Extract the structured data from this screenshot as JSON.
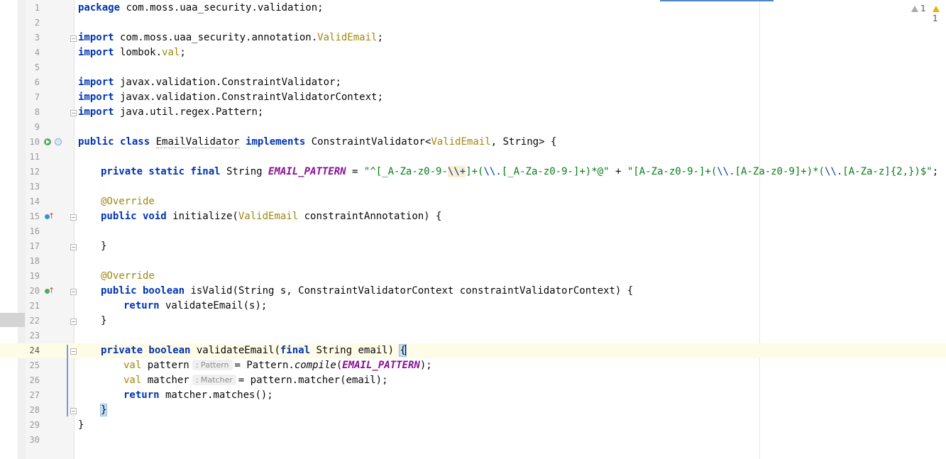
{
  "inspections": {
    "weak_count": "1",
    "warning_count": "1"
  },
  "lines": [
    {
      "num": "1"
    },
    {
      "num": "2"
    },
    {
      "num": "3"
    },
    {
      "num": "4"
    },
    {
      "num": "5"
    },
    {
      "num": "6"
    },
    {
      "num": "7"
    },
    {
      "num": "8"
    },
    {
      "num": "9"
    },
    {
      "num": "10"
    },
    {
      "num": "11"
    },
    {
      "num": "12"
    },
    {
      "num": "13"
    },
    {
      "num": "14"
    },
    {
      "num": "15"
    },
    {
      "num": "16"
    },
    {
      "num": "17"
    },
    {
      "num": "18"
    },
    {
      "num": "19"
    },
    {
      "num": "20"
    },
    {
      "num": "21"
    },
    {
      "num": "22"
    },
    {
      "num": "23"
    },
    {
      "num": "24"
    },
    {
      "num": "25"
    },
    {
      "num": "26"
    },
    {
      "num": "27"
    },
    {
      "num": "28"
    },
    {
      "num": "29"
    },
    {
      "num": "30"
    }
  ],
  "code": {
    "l1_kw": "package",
    "l1_rest": " com.moss.uaa_security.validation;",
    "l3_kw": "import",
    "l3_a": " com.moss.uaa_security.annotation.",
    "l3_type": "ValidEmail",
    "l3_b": ";",
    "l4_kw": "import",
    "l4_a": " lombok.",
    "l4_type": "val",
    "l4_b": ";",
    "l6_kw": "import",
    "l6_a": " javax.validation.ConstraintValidator;",
    "l7_kw": "import",
    "l7_a": " javax.validation.ConstraintValidatorContext;",
    "l8_kw": "import",
    "l8_a": " java.util.regex.Pattern;",
    "l10_kw1": "public",
    "l10_kw2": " class",
    "l10_name": "EmailValidator",
    "l10_kw3": " implements",
    "l10_a": " ConstraintValidator<",
    "l10_type": "ValidEmail",
    "l10_b": ", String> {",
    "l12_kw": "private static final",
    "l12_a": " String ",
    "l12_field": "EMAIL_PATTERN",
    "l12_b": " = ",
    "l12_s1": "\"^[_A-Za-z0-9-",
    "l12_esc": "\\\\+",
    "l12_s2": "]+(",
    "l12_s3": "\\\\.",
    "l12_s4": "[_A-Za-z0-9-]+)*@\"",
    "l12_plus": " + ",
    "l12_s5": "\"[A-Za-z0-9-]+(",
    "l12_s6": "\\\\.",
    "l12_s7": "[A-Za-z0-9]+)*(",
    "l12_s8": "\\\\.",
    "l12_s9": "[A-Za-z]{2,})$\"",
    "l12_end": ";",
    "l14_ann": "@Override",
    "l15_kw": "public void",
    "l15_a": " initialize(",
    "l15_type": "ValidEmail",
    "l15_b": " constraintAnnotation) {",
    "l17_a": "}",
    "l19_ann": "@Override",
    "l20_kw": "public boolean",
    "l20_a": " isValid(String s, ConstraintValidatorContext constraintValidatorContext) {",
    "l21_kw": "return",
    "l21_a": " validateEmail(s);",
    "l22_a": "}",
    "l24_kw": "private boolean",
    "l24_a": " validateEmail(",
    "l24_kw2": "final",
    "l24_b": " String email) ",
    "l24_brace": "{",
    "l25_kw": "val",
    "l25_a": " pattern",
    "l25_hint": ": Pattern",
    "l25_b": "= Pattern.",
    "l25_m": "compile",
    "l25_c": "(",
    "l25_f": "EMAIL_PATTERN",
    "l25_d": ");",
    "l26_kw": "val",
    "l26_a": " matcher",
    "l26_hint": ": Matcher",
    "l26_b": "= pattern.matcher(email);",
    "l27_kw": "return",
    "l27_a": " matcher.matches();",
    "l28_brace": "}",
    "l29_a": "}"
  }
}
